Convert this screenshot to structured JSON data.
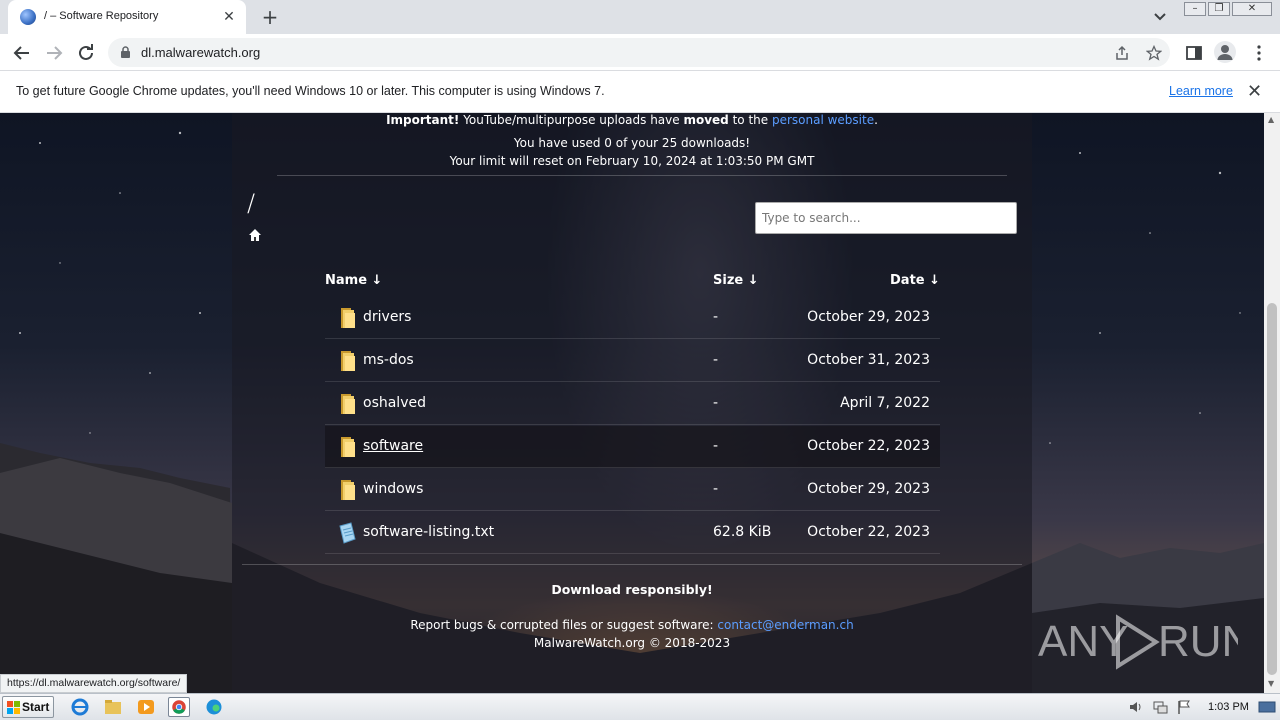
{
  "browser": {
    "tab_title": "/ – Software Repository",
    "url": "dl.malwarewatch.org",
    "status_url": "https://dl.malwarewatch.org/software/"
  },
  "infobar": {
    "message": "To get future Google Chrome updates, you'll need Windows 10 or later. This computer is using Windows 7.",
    "learn_more": "Learn more"
  },
  "page": {
    "notice_strong": "Important!",
    "notice_text": " YouTube/multipurpose uploads have ",
    "notice_moved": "moved",
    "notice_to": " to the ",
    "notice_link": "personal website",
    "notice_end": ".",
    "downloads_used": "You have used 0 of your 25 downloads!",
    "limit_reset": "Your limit will reset on February 10, 2024 at 1:03:50 PM GMT",
    "breadcrumb": "/",
    "search_placeholder": "Type to search...",
    "columns": {
      "name": "Name ↓",
      "size": "Size ↓",
      "date": "Date ↓"
    },
    "files": [
      {
        "name": "drivers",
        "size": "-",
        "date": "October 29, 2023",
        "type": "folder"
      },
      {
        "name": "ms-dos",
        "size": "-",
        "date": "October 31, 2023",
        "type": "folder"
      },
      {
        "name": "oshalved",
        "size": "-",
        "date": "April 7, 2022",
        "type": "folder"
      },
      {
        "name": "software",
        "size": "-",
        "date": "October 22, 2023",
        "type": "folder",
        "highlighted": true
      },
      {
        "name": "windows",
        "size": "-",
        "date": "October 29, 2023",
        "type": "folder"
      },
      {
        "name": "software-listing.txt",
        "size": "62.8 KiB",
        "date": "October 22, 2023",
        "type": "text-file"
      }
    ],
    "footer_download": "Download responsibly!",
    "footer_report": "Report bugs & corrupted files or suggest software: ",
    "footer_email": "contact@enderman.ch",
    "footer_copyright": "MalwareWatch.org © 2018-2023"
  },
  "taskbar": {
    "start_label": "Start",
    "clock": "1:03 PM",
    "apps": [
      "ie-icon",
      "explorer-icon",
      "media-player-icon",
      "chrome-icon",
      "edge-icon"
    ]
  },
  "watermark": {
    "brand": "ANY RUN"
  },
  "colors": {
    "link": "#5b9dff",
    "chrome_accent": "#1a73e8"
  }
}
